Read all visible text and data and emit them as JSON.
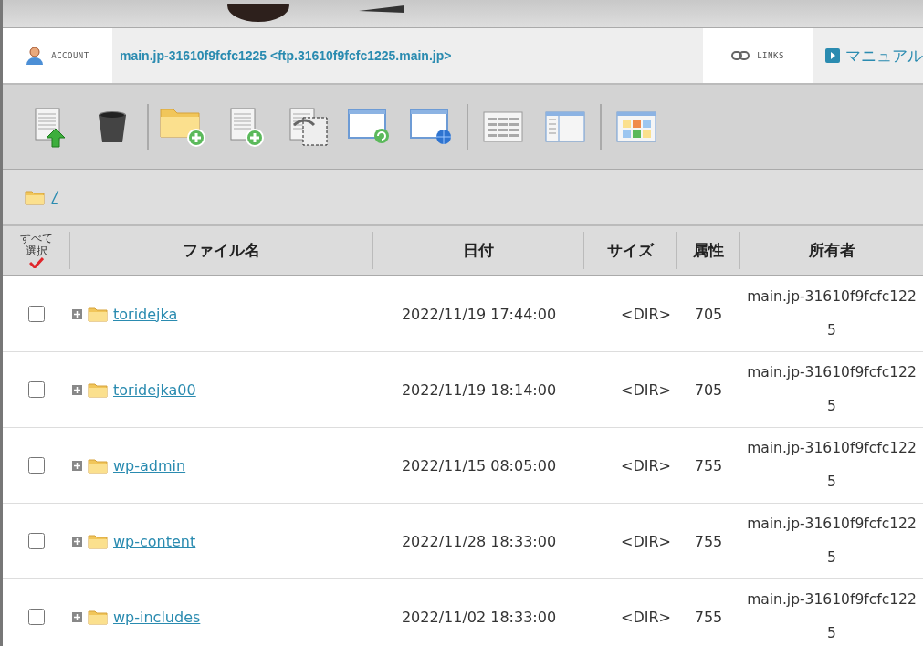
{
  "account_bar": {
    "account_label": "ACCOUNT",
    "account_name": "main.jp-31610f9fcfc1225 <ftp.31610f9fcfc1225.main.jp>",
    "links_label": "LINKS",
    "manual_link": "マニュアル"
  },
  "breadcrumb": {
    "path": "/"
  },
  "table": {
    "columns": [
      "すべて選択",
      "ファイル名",
      "日付",
      "サイズ",
      "属性",
      "所有者"
    ],
    "rows": [
      {
        "checked": false,
        "name": "toridejka",
        "date": "2022/11/19 17:44:00",
        "size": "<DIR>",
        "attr": "705",
        "owner": "main.jp-31610f9fcfc1225"
      },
      {
        "checked": false,
        "name": "toridejka00",
        "date": "2022/11/19 18:14:00",
        "size": "<DIR>",
        "attr": "705",
        "owner": "main.jp-31610f9fcfc1225"
      },
      {
        "checked": false,
        "name": "wp-admin",
        "date": "2022/11/15 08:05:00",
        "size": "<DIR>",
        "attr": "755",
        "owner": "main.jp-31610f9fcfc1225"
      },
      {
        "checked": false,
        "name": "wp-content",
        "date": "2022/11/28 18:33:00",
        "size": "<DIR>",
        "attr": "755",
        "owner": "main.jp-31610f9fcfc1225"
      },
      {
        "checked": false,
        "name": "wp-includes",
        "date": "2022/11/02 18:33:00",
        "size": "<DIR>",
        "attr": "755",
        "owner": "main.jp-31610f9fcfc1225"
      }
    ]
  }
}
